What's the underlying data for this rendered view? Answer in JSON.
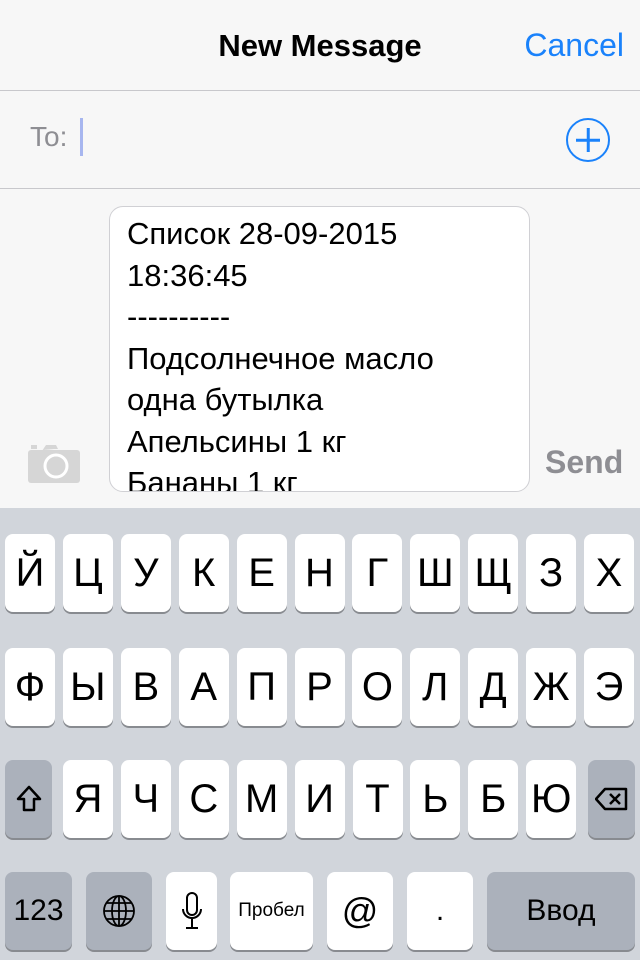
{
  "header": {
    "title": "New Message",
    "cancel_label": "Cancel"
  },
  "to": {
    "label": "To:",
    "value": "",
    "add_icon": "plus-circle-icon"
  },
  "compose": {
    "message_lines": [
      "Список 28-09-2015",
      "18:36:45",
      "----------",
      "Подсолнечное масло",
      "одна бутылка",
      "Апельсины 1 кг",
      "Бананы 1 кг"
    ],
    "send_label": "Send",
    "camera_icon": "camera-icon"
  },
  "keyboard": {
    "row1": [
      "Й",
      "Ц",
      "У",
      "К",
      "Е",
      "Н",
      "Г",
      "Ш",
      "Щ",
      "З",
      "Х"
    ],
    "row2": [
      "Ф",
      "Ы",
      "В",
      "А",
      "П",
      "Р",
      "О",
      "Л",
      "Д",
      "Ж",
      "Э"
    ],
    "row3": [
      "Я",
      "Ч",
      "С",
      "М",
      "И",
      "Т",
      "Ь",
      "Б",
      "Ю"
    ],
    "numbers_label": "123",
    "space_label": "Пробел",
    "at_label": "@",
    "period_label": ".",
    "return_label": "Ввод"
  },
  "colors": {
    "accent": "#1a82fb",
    "keyboard_bg": "#d1d5db",
    "dark_key": "#abb1bb"
  }
}
